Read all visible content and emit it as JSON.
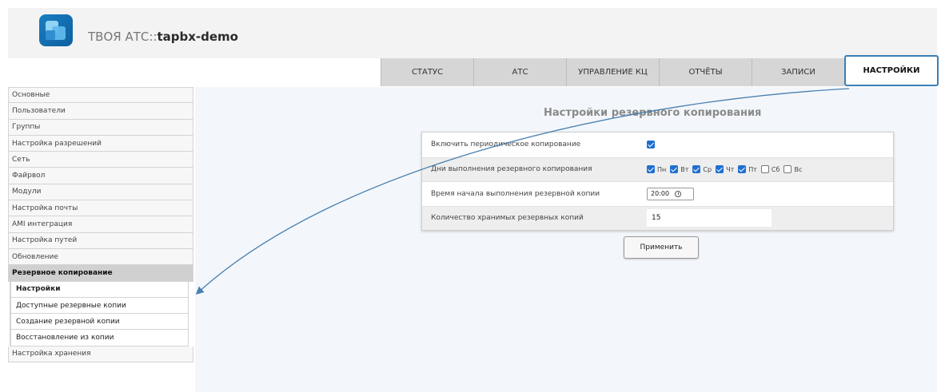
{
  "header": {
    "title_prefix": "ТВОЯ АТС::",
    "title_name": "tapbx-demo"
  },
  "tabs": [
    {
      "label": "СТАТУС"
    },
    {
      "label": "АТС"
    },
    {
      "label": "УПРАВЛЕНИЕ КЦ"
    },
    {
      "label": "ОТЧЁТЫ"
    },
    {
      "label": "ЗАПИСИ"
    },
    {
      "label": "НАСТРОЙКИ"
    }
  ],
  "sidebar": {
    "items_top": [
      {
        "label": "Основные"
      },
      {
        "label": "Пользователи"
      },
      {
        "label": "Группы"
      },
      {
        "label": "Настройка разрешений"
      },
      {
        "label": "Сеть"
      },
      {
        "label": "Файрвол"
      },
      {
        "label": "Модули"
      },
      {
        "label": "Настройка почты"
      },
      {
        "label": "AMI интеграция"
      },
      {
        "label": "Настройка путей"
      },
      {
        "label": "Обновление"
      }
    ],
    "active_section": "Резервное копирование",
    "sub_items": [
      {
        "label": "Настройки"
      },
      {
        "label": "Доступные резервные копии"
      },
      {
        "label": "Создание резервной копии"
      },
      {
        "label": "Восстановление из копии"
      }
    ],
    "items_bottom": [
      {
        "label": "Настройка хранения"
      }
    ]
  },
  "main": {
    "section_title": "Настройки резервного копирования",
    "rows": {
      "enable_label": "Включить периодическое копирование",
      "enable_checked": true,
      "days_label": "Дни выполнения резервного копирования",
      "days": [
        {
          "label": "Пн",
          "checked": true
        },
        {
          "label": "Вт",
          "checked": true
        },
        {
          "label": "Ср",
          "checked": true
        },
        {
          "label": "Чт",
          "checked": true
        },
        {
          "label": "Пт",
          "checked": true
        },
        {
          "label": "Сб",
          "checked": false
        },
        {
          "label": "Вс",
          "checked": false
        }
      ],
      "time_label": "Время начала выполнения резервной копии",
      "time_value": "20:00",
      "count_label": "Количество хранимых резервных копий",
      "count_value": "15"
    },
    "apply_label": "Применить"
  },
  "colors": {
    "checkbox_on": "#1f6fd1",
    "active_tab_border": "#3a7fb5",
    "annotation_arrow": "#4a7fb0",
    "tab_bg": "#d6d6d6",
    "content_bg": "#f3f7fb"
  },
  "icons": [
    "app-logo-icon",
    "clock-icon",
    "checkbox-icon",
    "annotation-arrow"
  ]
}
